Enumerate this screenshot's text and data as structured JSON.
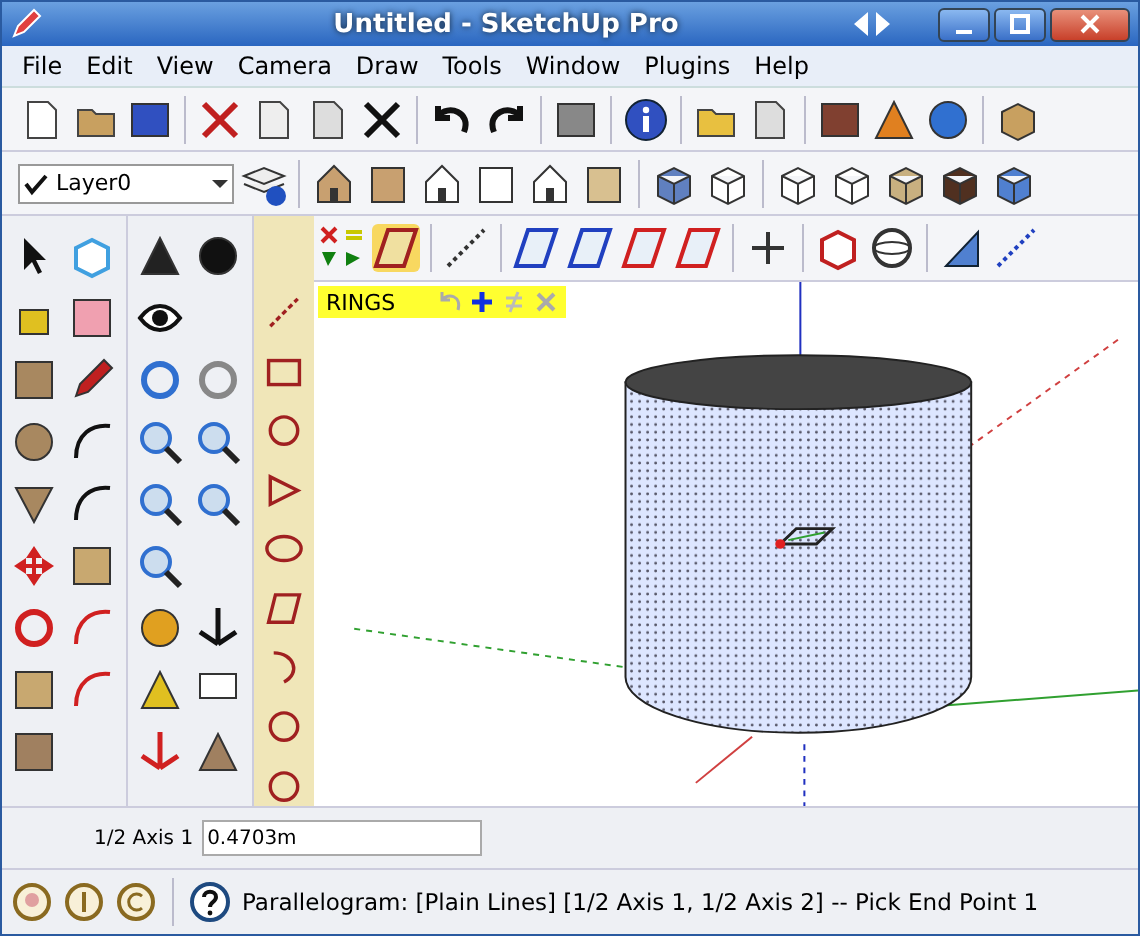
{
  "window": {
    "title": "Untitled - SketchUp Pro"
  },
  "menu": [
    "File",
    "Edit",
    "View",
    "Camera",
    "Draw",
    "Tools",
    "Window",
    "Plugins",
    "Help"
  ],
  "layer_dropdown": {
    "value": "Layer0",
    "checked": true
  },
  "rings_panel": {
    "title": "RINGS"
  },
  "measurements": {
    "label": "1/2 Axis 1",
    "value": "0.4703m"
  },
  "status_bar": {
    "text": "Parallelogram: [Plain Lines]  [1/2 Axis 1, 1/2 Axis 2] -- Pick End Point 1"
  }
}
